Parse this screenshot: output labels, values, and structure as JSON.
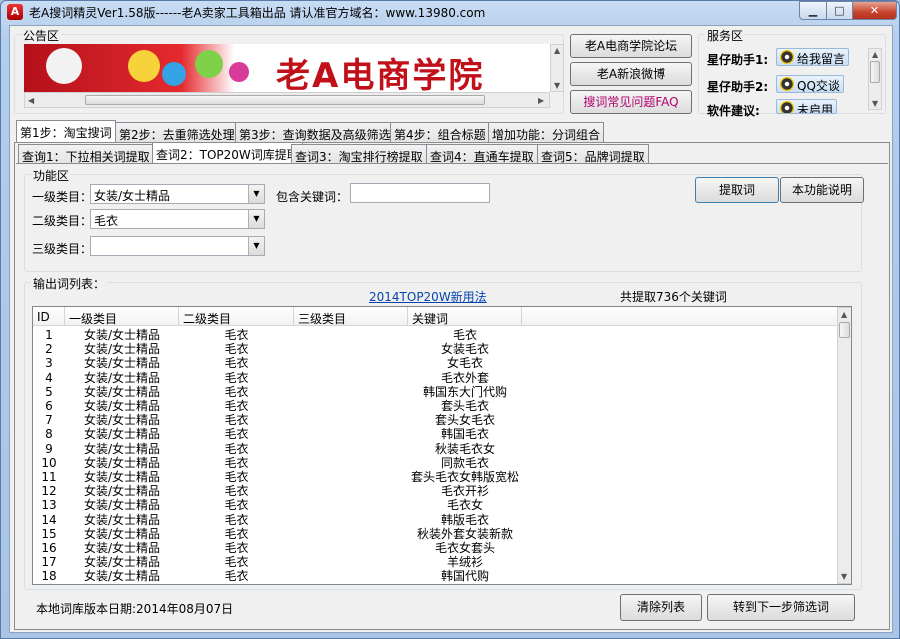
{
  "window": {
    "title": "老A搜词精灵Ver1.58版------老A卖家工具箱出品  请认准官方域名：www.13980.com"
  },
  "notice": {
    "label": "公告区",
    "banner_text": "老A电商学院"
  },
  "links": {
    "forum": "老A电商学院论坛",
    "weibo": "老A新浪微博",
    "faq": "搜词常见问题FAQ"
  },
  "service": {
    "label": "服务区",
    "assistant1_label": "星仔助手1:",
    "assistant1_btn": "给我留言",
    "assistant2_label": "星仔助手2:",
    "assistant2_btn": "QQ交谈",
    "suggest_label": "软件建议:",
    "suggest_btn": "未启用"
  },
  "main_tabs": [
    "第1步：淘宝搜词",
    "第2步：去重筛选处理",
    "第3步：查询数据及高级筛选",
    "第4步：组合标题",
    "增加功能：分词组合"
  ],
  "sub_tabs": [
    "查询1：下拉相关词提取",
    "查词2：TOP20W词库提取",
    "查词3：淘宝排行榜提取",
    "查词4：直通车提取",
    "查词5：品牌词提取"
  ],
  "function_area": {
    "label": "功能区",
    "cat1_label": "一级类目：",
    "cat1_value": "女装/女士精品",
    "cat2_label": "二级类目：",
    "cat2_value": "毛衣",
    "cat3_label": "三级类目：",
    "cat3_value": "",
    "keyword_label": "包含关键词：",
    "keyword_value": "",
    "extract_btn": "提取词",
    "help_btn": "本功能说明"
  },
  "output": {
    "label": "输出词列表：",
    "link": "2014TOP20W新用法",
    "total": "共提取736个关键词",
    "columns": [
      "ID",
      "一级类目",
      "二级类目",
      "三级类目",
      "关键词"
    ],
    "rows": [
      [
        "1",
        "女装/女士精品",
        "毛衣",
        "",
        "毛衣"
      ],
      [
        "2",
        "女装/女士精品",
        "毛衣",
        "",
        "女装毛衣"
      ],
      [
        "3",
        "女装/女士精品",
        "毛衣",
        "",
        "女毛衣"
      ],
      [
        "4",
        "女装/女士精品",
        "毛衣",
        "",
        "毛衣外套"
      ],
      [
        "5",
        "女装/女士精品",
        "毛衣",
        "",
        "韩国东大门代购"
      ],
      [
        "6",
        "女装/女士精品",
        "毛衣",
        "",
        "套头毛衣"
      ],
      [
        "7",
        "女装/女士精品",
        "毛衣",
        "",
        "套头女毛衣"
      ],
      [
        "8",
        "女装/女士精品",
        "毛衣",
        "",
        "韩国毛衣"
      ],
      [
        "9",
        "女装/女士精品",
        "毛衣",
        "",
        "秋装毛衣女"
      ],
      [
        "10",
        "女装/女士精品",
        "毛衣",
        "",
        "同款毛衣"
      ],
      [
        "11",
        "女装/女士精品",
        "毛衣",
        "",
        "套头毛衣女韩版宽松"
      ],
      [
        "12",
        "女装/女士精品",
        "毛衣",
        "",
        "毛衣开衫"
      ],
      [
        "13",
        "女装/女士精品",
        "毛衣",
        "",
        "毛衣女"
      ],
      [
        "14",
        "女装/女士精品",
        "毛衣",
        "",
        "韩版毛衣"
      ],
      [
        "15",
        "女装/女士精品",
        "毛衣",
        "",
        "秋装外套女装新款"
      ],
      [
        "16",
        "女装/女士精品",
        "毛衣",
        "",
        "毛衣女套头"
      ],
      [
        "17",
        "女装/女士精品",
        "毛衣",
        "",
        "羊绒衫"
      ],
      [
        "18",
        "女装/女士精品",
        "毛衣",
        "",
        "韩国代购"
      ]
    ]
  },
  "footer": {
    "date_label": "本地词库版本日期:2014年08月07日",
    "clear_btn": "清除列表",
    "next_btn": "转到下一步筛选词"
  },
  "colors": {
    "link": "#0645ad",
    "faq": "#b0006e",
    "banner_red": "#c0101a"
  }
}
